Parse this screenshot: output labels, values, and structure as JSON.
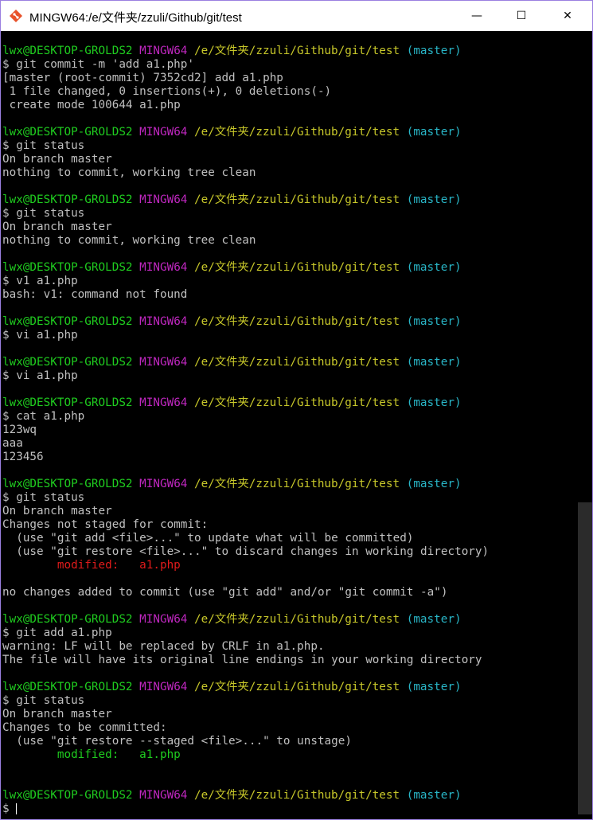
{
  "window": {
    "title": "MINGW64:/e/文件夹/zzuli/Github/git/test",
    "app_icon": "git-bash-icon",
    "controls": {
      "minimize": "—",
      "maximize": "☐",
      "close": "✕"
    }
  },
  "terminal": {
    "prompt": {
      "user": "lwx@DESKTOP-GROLDS2",
      "shell": "MINGW64",
      "path": "/e/文件夹/zzuli/Github/git/test",
      "branch": "(master)"
    },
    "lines": [
      {
        "type": "prompt"
      },
      {
        "type": "text",
        "text": "$ git commit -m 'add a1.php'"
      },
      {
        "type": "text",
        "text": "[master (root-commit) 7352cd2] add a1.php"
      },
      {
        "type": "text",
        "text": " 1 file changed, 0 insertions(+), 0 deletions(-)"
      },
      {
        "type": "text",
        "text": " create mode 100644 a1.php"
      },
      {
        "type": "blank"
      },
      {
        "type": "prompt"
      },
      {
        "type": "text",
        "text": "$ git status"
      },
      {
        "type": "text",
        "text": "On branch master"
      },
      {
        "type": "text",
        "text": "nothing to commit, working tree clean"
      },
      {
        "type": "blank"
      },
      {
        "type": "prompt"
      },
      {
        "type": "text",
        "text": "$ git status"
      },
      {
        "type": "text",
        "text": "On branch master"
      },
      {
        "type": "text",
        "text": "nothing to commit, working tree clean"
      },
      {
        "type": "blank"
      },
      {
        "type": "prompt"
      },
      {
        "type": "text",
        "text": "$ v1 a1.php"
      },
      {
        "type": "text",
        "text": "bash: v1: command not found"
      },
      {
        "type": "blank"
      },
      {
        "type": "prompt"
      },
      {
        "type": "text",
        "text": "$ vi a1.php"
      },
      {
        "type": "blank"
      },
      {
        "type": "prompt"
      },
      {
        "type": "text",
        "text": "$ vi a1.php"
      },
      {
        "type": "blank"
      },
      {
        "type": "prompt"
      },
      {
        "type": "text",
        "text": "$ cat a1.php"
      },
      {
        "type": "text",
        "text": "123wq"
      },
      {
        "type": "text",
        "text": "aaa"
      },
      {
        "type": "text",
        "text": "123456"
      },
      {
        "type": "blank"
      },
      {
        "type": "prompt"
      },
      {
        "type": "text",
        "text": "$ git status"
      },
      {
        "type": "text",
        "text": "On branch master"
      },
      {
        "type": "text",
        "text": "Changes not staged for commit:"
      },
      {
        "type": "text",
        "text": "  (use \"git add <file>...\" to update what will be committed)"
      },
      {
        "type": "text",
        "text": "  (use \"git restore <file>...\" to discard changes in working directory)"
      },
      {
        "type": "text",
        "text": "        modified:   a1.php",
        "color": "red"
      },
      {
        "type": "blank"
      },
      {
        "type": "text",
        "text": "no changes added to commit (use \"git add\" and/or \"git commit -a\")"
      },
      {
        "type": "blank"
      },
      {
        "type": "prompt"
      },
      {
        "type": "text",
        "text": "$ git add a1.php"
      },
      {
        "type": "text",
        "text": "warning: LF will be replaced by CRLF in a1.php."
      },
      {
        "type": "text",
        "text": "The file will have its original line endings in your working directory"
      },
      {
        "type": "blank"
      },
      {
        "type": "prompt"
      },
      {
        "type": "text",
        "text": "$ git status"
      },
      {
        "type": "text",
        "text": "On branch master"
      },
      {
        "type": "text",
        "text": "Changes to be committed:"
      },
      {
        "type": "text",
        "text": "  (use \"git restore --staged <file>...\" to unstage)"
      },
      {
        "type": "text",
        "text": "        modified:   a1.php",
        "color": "green"
      },
      {
        "type": "blank"
      },
      {
        "type": "blank"
      },
      {
        "type": "prompt"
      },
      {
        "type": "input",
        "text": "$ "
      }
    ]
  },
  "colors": {
    "background": "#000000",
    "text": "#c0c0c0",
    "user_host": "#1fcc1f",
    "shell": "#bf27bf",
    "path": "#c8c82a",
    "branch": "#29b6c7",
    "modified_unstaged": "#e01b1b",
    "modified_staged": "#1fcc1f"
  }
}
